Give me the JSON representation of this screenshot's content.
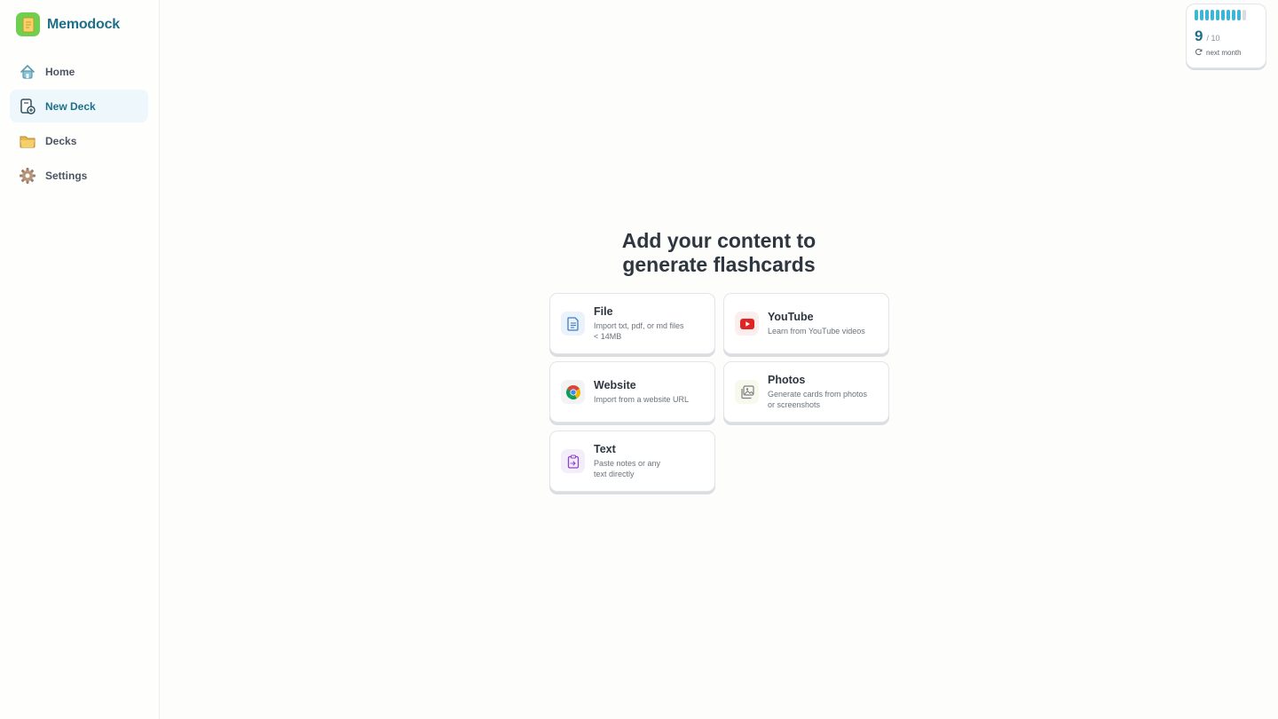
{
  "app": {
    "name": "Memodock"
  },
  "sidebar": {
    "items": [
      {
        "label": "Home",
        "icon": "home-icon",
        "active": false
      },
      {
        "label": "New Deck",
        "icon": "new-deck-icon",
        "active": true
      },
      {
        "label": "Decks",
        "icon": "folder-icon",
        "active": false
      },
      {
        "label": "Settings",
        "icon": "gear-icon",
        "active": false
      }
    ]
  },
  "usage": {
    "used": "9",
    "total": "/ 10",
    "reset_label": "next month",
    "used_value": 9,
    "max_value": 10
  },
  "main": {
    "headline_line1": "Add your content to",
    "headline_line2": "generate flashcards",
    "options": {
      "file": {
        "title": "File",
        "desc_line1": "Import txt, pdf, or md files",
        "desc_line2": "< 14MB",
        "icon": "document-icon"
      },
      "youtube": {
        "title": "YouTube",
        "desc_line1": "Learn from YouTube videos",
        "icon": "youtube-icon"
      },
      "website": {
        "title": "Website",
        "desc_line1": "Import from a website URL",
        "icon": "chrome-icon"
      },
      "photos": {
        "title": "Photos",
        "desc_line1": "Generate cards from photos",
        "desc_line2": "or screenshots",
        "icon": "image-icon"
      },
      "text": {
        "title": "Text",
        "desc_line1": "Paste notes or any",
        "desc_line2": "text directly",
        "icon": "clipboard-icon"
      }
    }
  },
  "colors": {
    "accent": "#1f6f8b",
    "usage_bar": "#3ab7d6",
    "brand_logo": "#6fcf4e",
    "youtube_red": "#e02424"
  }
}
